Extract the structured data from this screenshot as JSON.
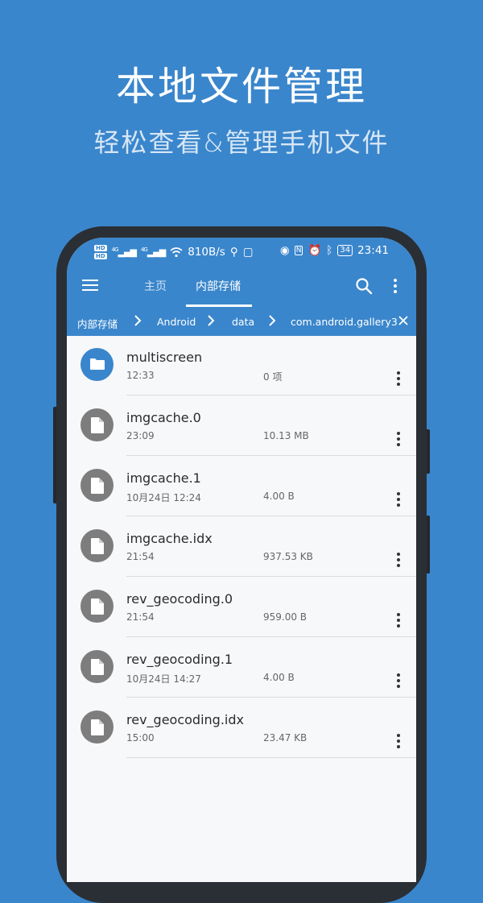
{
  "promo": {
    "title": "本地文件管理",
    "subtitle": "轻松查看&管理手机文件"
  },
  "statusbar": {
    "hd1": "HD",
    "hd2": "HD",
    "net1": "4G",
    "net2": "4G",
    "speed": "810B/s",
    "battery": "34",
    "time": "23:41"
  },
  "toolbar": {
    "tab_home": "主页",
    "tab_storage": "内部存储"
  },
  "breadcrumb": {
    "items": [
      "内部存储",
      "Android",
      "data",
      "com.android.gallery3"
    ]
  },
  "files": [
    {
      "name": "multiscreen",
      "time": "12:33",
      "size": "0 项",
      "type": "folder"
    },
    {
      "name": "imgcache.0",
      "time": "23:09",
      "size": "10.13 MB",
      "type": "file"
    },
    {
      "name": "imgcache.1",
      "time": "10月24日 12:24",
      "size": "4.00 B",
      "type": "file"
    },
    {
      "name": "imgcache.idx",
      "time": "21:54",
      "size": "937.53 KB",
      "type": "file"
    },
    {
      "name": "rev_geocoding.0",
      "time": "21:54",
      "size": "959.00 B",
      "type": "file"
    },
    {
      "name": "rev_geocoding.1",
      "time": "10月24日 14:27",
      "size": "4.00 B",
      "type": "file"
    },
    {
      "name": "rev_geocoding.idx",
      "time": "15:00",
      "size": "23.47 KB",
      "type": "file"
    }
  ],
  "colors": {
    "accent": "#3a86cc",
    "file_icon": "#7d7d7d",
    "background": "#f7f8fa"
  }
}
